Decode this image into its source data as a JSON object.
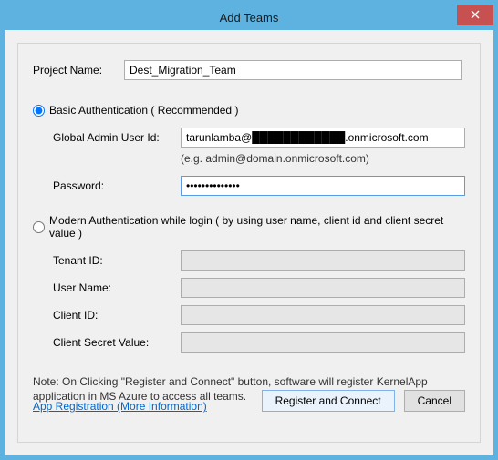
{
  "dialog": {
    "title": "Add Teams",
    "close_icon": "×"
  },
  "project": {
    "label": "Project Name:",
    "value": "Dest_Migration_Team"
  },
  "auth": {
    "basic": {
      "radio_label": "Basic Authentication ( Recommended )",
      "selected": true,
      "user_label": "Global Admin User Id:",
      "user_value": "tarunlamba@████████████.onmicrosoft.com",
      "user_hint": "(e.g. admin@domain.onmicrosoft.com)",
      "password_label": "Password:",
      "password_value": "••••••••••••••"
    },
    "modern": {
      "radio_label": "Modern Authentication while login ( by using user name, client id and client secret value )",
      "selected": false,
      "tenant_label": "Tenant ID:",
      "tenant_value": "",
      "username_label": "User Name:",
      "username_value": "",
      "clientid_label": "Client ID:",
      "clientid_value": "",
      "secret_label": "Client Secret Value:",
      "secret_value": ""
    }
  },
  "footer": {
    "note": "Note: On Clicking \"Register and Connect\" button, software will register KernelApp application in MS Azure to access all teams.",
    "link": "App Registration (More Information)",
    "register_btn": "Register and Connect",
    "cancel_btn": "Cancel"
  }
}
